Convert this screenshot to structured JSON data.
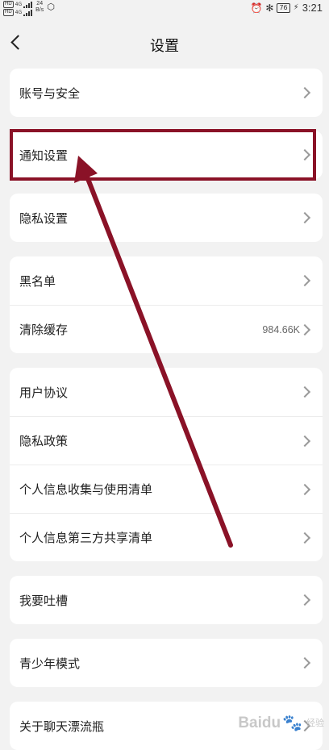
{
  "status_bar": {
    "sim1": "HD",
    "sim2": "HD",
    "net1": "4G",
    "net2": "4G",
    "speed_value": "24",
    "speed_unit": "B/s",
    "battery": "76",
    "time": "3:21"
  },
  "header": {
    "title": "设置"
  },
  "groups": [
    {
      "items": [
        {
          "label": "账号与安全"
        }
      ]
    },
    {
      "items": [
        {
          "label": "通知设置"
        }
      ]
    },
    {
      "items": [
        {
          "label": "隐私设置"
        }
      ]
    },
    {
      "items": [
        {
          "label": "黑名单"
        },
        {
          "label": "清除缓存",
          "value": "984.66K"
        }
      ]
    },
    {
      "items": [
        {
          "label": "用户协议"
        },
        {
          "label": "隐私政策"
        },
        {
          "label": "个人信息收集与使用清单"
        },
        {
          "label": "个人信息第三方共享清单"
        }
      ]
    },
    {
      "items": [
        {
          "label": "我要吐槽"
        }
      ]
    },
    {
      "items": [
        {
          "label": "青少年模式"
        }
      ]
    },
    {
      "items": [
        {
          "label": "关于聊天漂流瓶"
        }
      ]
    }
  ],
  "annotation": {
    "color": "#8a1227"
  },
  "watermark": {
    "text": "Baidu",
    "suffix": "经验"
  }
}
